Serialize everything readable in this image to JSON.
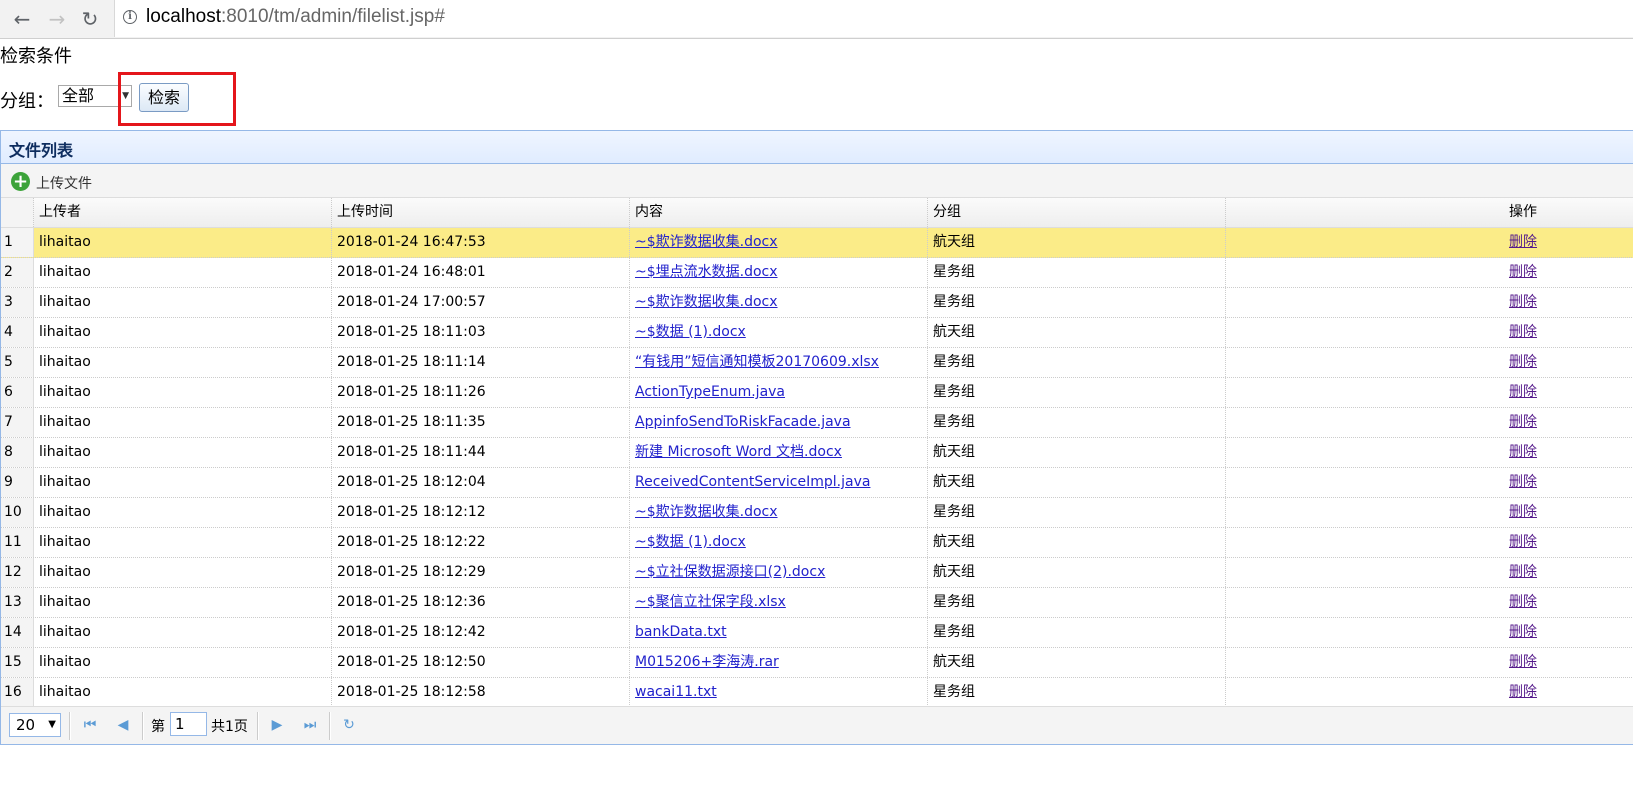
{
  "browser": {
    "url_host": "localhost",
    "url_rest": ":8010/tm/admin/filelist.jsp#"
  },
  "search": {
    "title": "检索条件",
    "group_label": "分组：",
    "group_value": "全部",
    "search_button": "检索"
  },
  "panel": {
    "title": "文件列表",
    "upload_label": "上传文件"
  },
  "grid": {
    "columns": [
      "上传者",
      "上传时间",
      "内容",
      "分组",
      "操作"
    ],
    "rows": [
      {
        "num": "1",
        "uploader": "lihaitao",
        "time": "2018-01-24 16:47:53",
        "file": "~$欺诈数据收集.docx",
        "group": "航天组",
        "action": "删除"
      },
      {
        "num": "2",
        "uploader": "lihaitao",
        "time": "2018-01-24 16:48:01",
        "file": "~$埋点流水数据.docx",
        "group": "星务组",
        "action": "删除"
      },
      {
        "num": "3",
        "uploader": "lihaitao",
        "time": "2018-01-24 17:00:57",
        "file": "~$欺诈数据收集.docx",
        "group": "星务组",
        "action": "删除"
      },
      {
        "num": "4",
        "uploader": "lihaitao",
        "time": "2018-01-25 18:11:03",
        "file": "~$数据 (1).docx",
        "group": "航天组",
        "action": "删除"
      },
      {
        "num": "5",
        "uploader": "lihaitao",
        "time": "2018-01-25 18:11:14",
        "file": "“有钱用”短信通知模板20170609.xlsx",
        "group": "星务组",
        "action": "删除"
      },
      {
        "num": "6",
        "uploader": "lihaitao",
        "time": "2018-01-25 18:11:26",
        "file": "ActionTypeEnum.java",
        "group": "星务组",
        "action": "删除"
      },
      {
        "num": "7",
        "uploader": "lihaitao",
        "time": "2018-01-25 18:11:35",
        "file": "AppinfoSendToRiskFacade.java",
        "group": "星务组",
        "action": "删除"
      },
      {
        "num": "8",
        "uploader": "lihaitao",
        "time": "2018-01-25 18:11:44",
        "file": "新建 Microsoft Word 文档.docx",
        "group": "航天组",
        "action": "删除"
      },
      {
        "num": "9",
        "uploader": "lihaitao",
        "time": "2018-01-25 18:12:04",
        "file": "ReceivedContentServiceImpl.java",
        "group": "航天组",
        "action": "删除"
      },
      {
        "num": "10",
        "uploader": "lihaitao",
        "time": "2018-01-25 18:12:12",
        "file": "~$欺诈数据收集.docx",
        "group": "星务组",
        "action": "删除"
      },
      {
        "num": "11",
        "uploader": "lihaitao",
        "time": "2018-01-25 18:12:22",
        "file": "~$数据 (1).docx",
        "group": "航天组",
        "action": "删除"
      },
      {
        "num": "12",
        "uploader": "lihaitao",
        "time": "2018-01-25 18:12:29",
        "file": "~$立社保数据源接口(2).docx",
        "group": "航天组",
        "action": "删除"
      },
      {
        "num": "13",
        "uploader": "lihaitao",
        "time": "2018-01-25 18:12:36",
        "file": "~$聚信立社保字段.xlsx",
        "group": "星务组",
        "action": "删除"
      },
      {
        "num": "14",
        "uploader": "lihaitao",
        "time": "2018-01-25 18:12:42",
        "file": "bankData.txt",
        "group": "星务组",
        "action": "删除"
      },
      {
        "num": "15",
        "uploader": "lihaitao",
        "time": "2018-01-25 18:12:50",
        "file": "M015206+李海涛.rar",
        "group": "航天组",
        "action": "删除"
      },
      {
        "num": "16",
        "uploader": "lihaitao",
        "time": "2018-01-25 18:12:58",
        "file": "wacai11.txt",
        "group": "星务组",
        "action": "删除"
      }
    ]
  },
  "pager": {
    "page_size": "20",
    "page_prefix": "第",
    "page_number": "1",
    "page_total": "共1页"
  },
  "colors": {
    "selected_row": "#fbec88",
    "panel_border": "#95b8e7",
    "highlight_box": "#e4161b"
  }
}
